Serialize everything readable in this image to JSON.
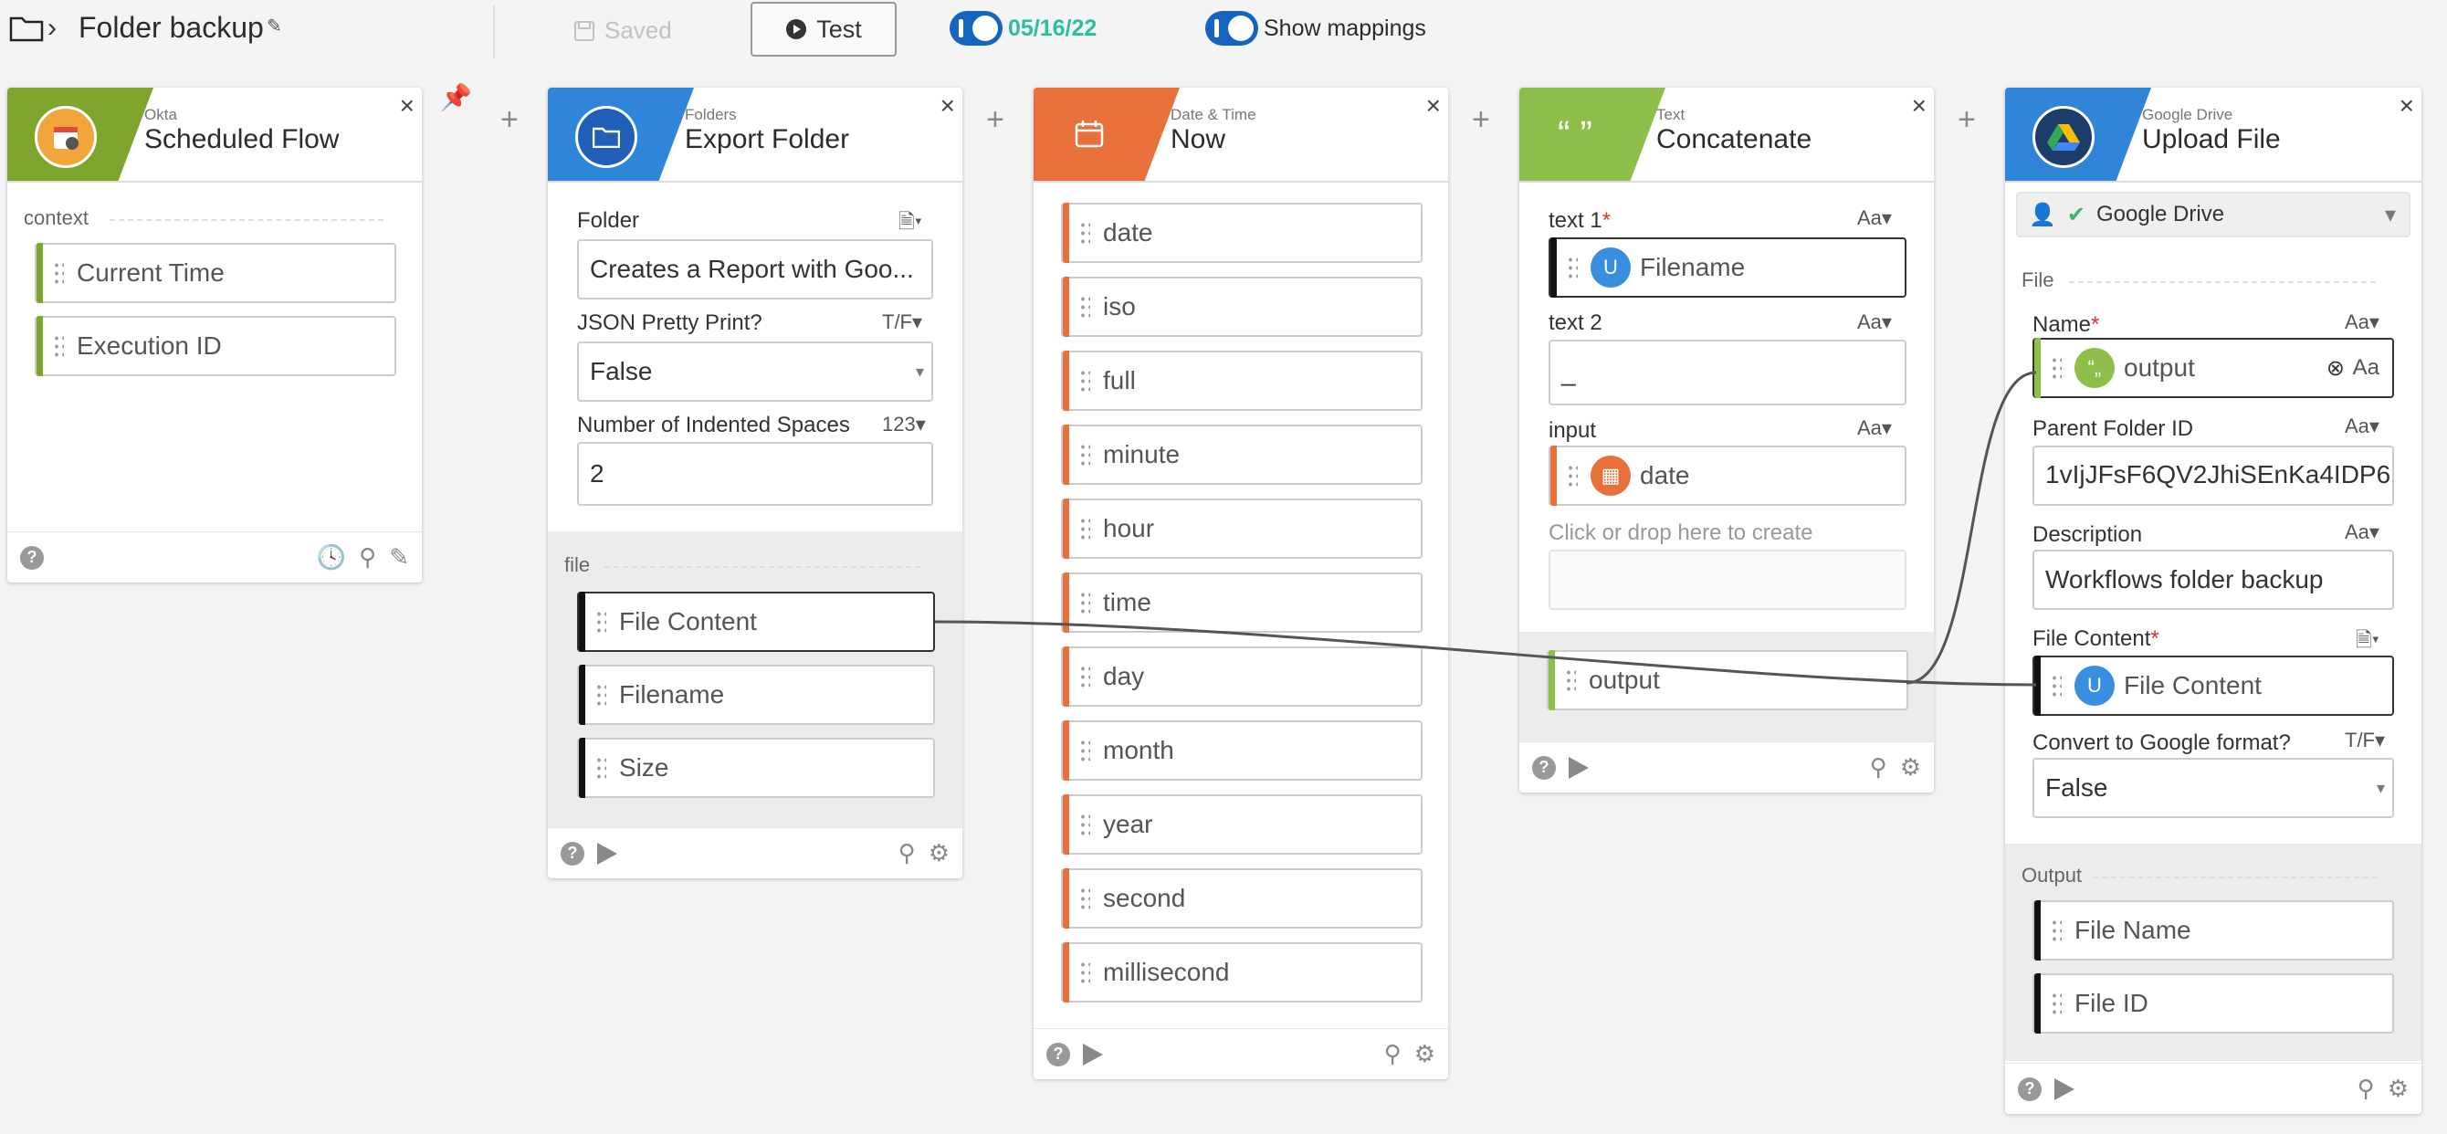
{
  "topbar": {
    "flow_title": "Folder backup",
    "saved_label": "Saved",
    "test_label": "Test",
    "date_label": "05/16/22",
    "mappings_label": "Show mappings"
  },
  "colors": {
    "okta": "#7ea62e",
    "folders": "#2f86d8",
    "datetime": "#e8703a",
    "text": "#8dbf4a",
    "gdrive": "#2f86d8"
  },
  "cards": {
    "okta": {
      "app": "Okta",
      "title": "Scheduled Flow",
      "section": "context",
      "outputs": [
        "Current Time",
        "Execution ID"
      ]
    },
    "folders": {
      "app": "Folders",
      "title": "Export Folder",
      "folder_label": "Folder",
      "folder_value": "Creates a Report with Goo...",
      "pretty_label": "JSON Pretty Print?",
      "pretty_type": "T/F",
      "pretty_value": "False",
      "indent_label": "Number of Indented Spaces",
      "indent_type": "123",
      "indent_value": "2",
      "section": "file",
      "outputs": [
        "File Content",
        "Filename",
        "Size"
      ]
    },
    "datetime": {
      "app": "Date & Time",
      "title": "Now",
      "outputs": [
        "date",
        "iso",
        "full",
        "minute",
        "hour",
        "time",
        "day",
        "month",
        "year",
        "second",
        "millisecond"
      ]
    },
    "text": {
      "app": "Text",
      "title": "Concatenate",
      "text1_label": "text 1",
      "text1_value": "Filename",
      "text1_badge": "U",
      "text2_label": "text 2",
      "text2_value": "_",
      "input_label": "input",
      "input_value": "date",
      "type": "Aa",
      "create_hint": "Click or drop here to create",
      "output": "output"
    },
    "gdrive": {
      "app": "Google Drive",
      "title": "Upload File",
      "connection": "Google Drive",
      "section": "File",
      "name_label": "Name",
      "name_value": "output",
      "parent_label": "Parent Folder ID",
      "parent_value": "1vIjJFsF6QV2JhiSEnKa4IDP6",
      "desc_label": "Description",
      "desc_value": "Workflows folder backup",
      "content_label": "File Content",
      "content_value": "File Content",
      "content_badge": "U",
      "convert_label": "Convert to Google format?",
      "convert_type": "T/F",
      "convert_value": "False",
      "type": "Aa",
      "output_section": "Output",
      "outputs": [
        "File Name",
        "File ID"
      ]
    }
  }
}
